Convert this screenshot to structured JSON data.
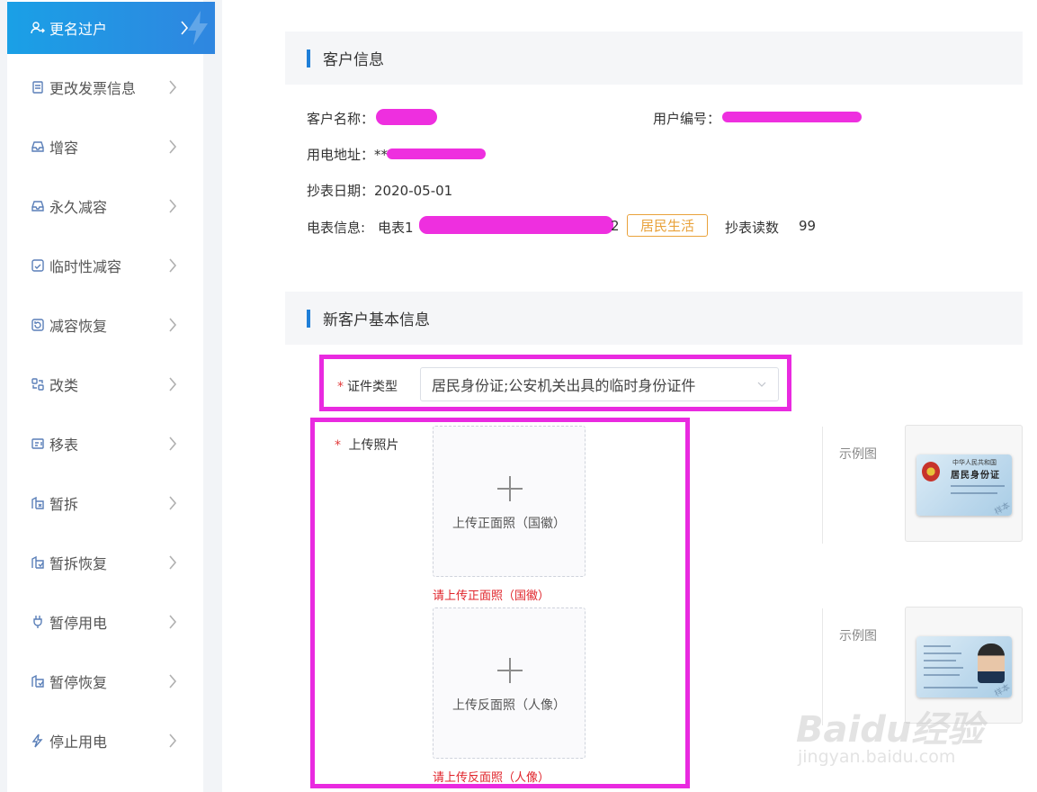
{
  "sidebar": {
    "items": [
      {
        "label": "更名过户",
        "icon": "user-switch-icon",
        "active": true
      },
      {
        "label": "更改发票信息",
        "icon": "invoice-icon",
        "active": false
      },
      {
        "label": "增容",
        "icon": "capacity-increase-icon",
        "active": false
      },
      {
        "label": "永久减容",
        "icon": "capacity-reduce-icon",
        "active": false
      },
      {
        "label": "临时性减容",
        "icon": "temp-reduce-icon",
        "active": false
      },
      {
        "label": "减容恢复",
        "icon": "restore-icon",
        "active": false
      },
      {
        "label": "改类",
        "icon": "category-change-icon",
        "active": false
      },
      {
        "label": "移表",
        "icon": "meter-move-icon",
        "active": false
      },
      {
        "label": "暂拆",
        "icon": "temp-remove-icon",
        "active": false
      },
      {
        "label": "暂拆恢复",
        "icon": "temp-remove-restore-icon",
        "active": false
      },
      {
        "label": "暂停用电",
        "icon": "plug-icon",
        "active": false
      },
      {
        "label": "暂停恢复",
        "icon": "pause-restore-icon",
        "active": false
      },
      {
        "label": "停止用电",
        "icon": "power-off-icon",
        "active": false
      }
    ]
  },
  "customer_info": {
    "title": "客户信息",
    "name_label": "客户名称：",
    "user_no_label": "用户编号：",
    "address_label": "用电地址：",
    "address_prefix": "**",
    "read_date_label": "抄表日期：",
    "read_date_value": "2020-05-01",
    "meter_label": "电表信息:",
    "meter_prefix": "电表1",
    "meter_suffix": "2",
    "meter_tag": "居民生活",
    "reading_label": "抄表读数",
    "reading_value": "99"
  },
  "new_customer": {
    "title": "新客户基本信息",
    "required_mark": "*",
    "id_type_label": "证件类型",
    "id_type_value": "居民身份证;公安机关出具的临时身份证件",
    "upload_label": "上传照片",
    "upload_front_text": "上传正面照（国徽）",
    "upload_front_error": "请上传正面照（国徽）",
    "upload_back_text": "上传反面照（人像）",
    "upload_back_error": "请上传反面照（人像）",
    "sample_label": "示例图",
    "card_front_title_small": "中华人民共和国",
    "card_front_title": "居民身份证",
    "card_stamp": "样本"
  },
  "watermark": {
    "brand": "Baidu经验",
    "url": "jingyan.baidu.com"
  },
  "colors": {
    "accent": "#1f7fd8",
    "active_nav": "#2f86e0",
    "highlight": "#e92ae0",
    "tag": "#e9a23b",
    "error": "#e0242b"
  }
}
